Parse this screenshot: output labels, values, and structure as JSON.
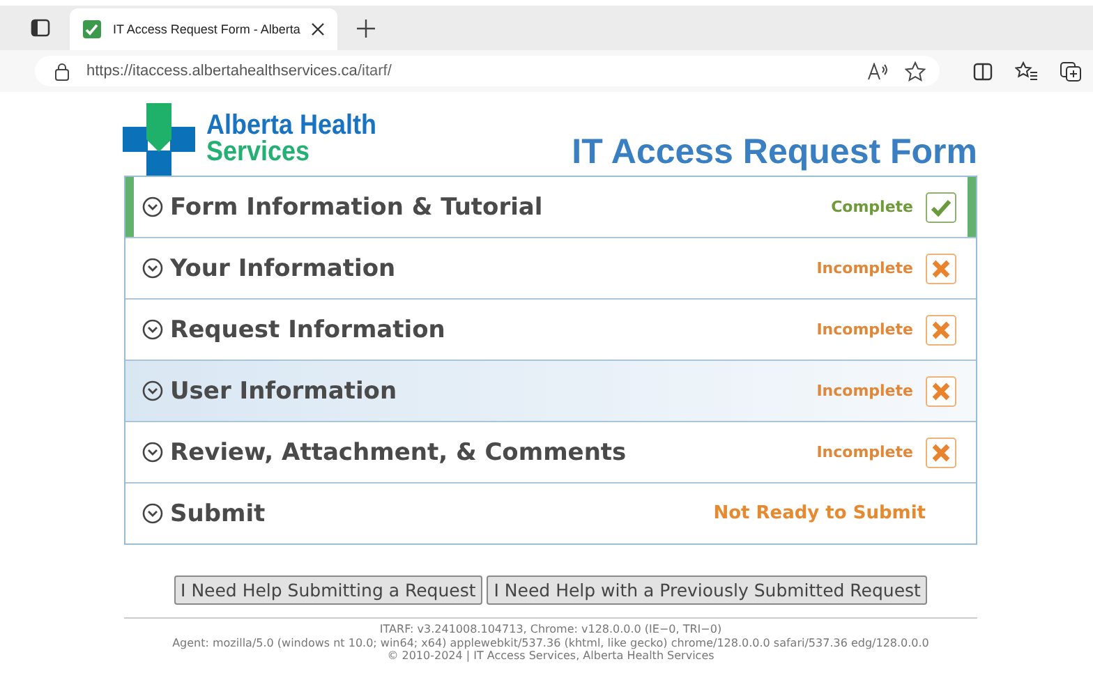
{
  "browser": {
    "tab_title": "IT Access Request Form - Alberta",
    "url_host": "https://itaccess.albertahealthservices.ca",
    "url_path": "/itarf/"
  },
  "logo": {
    "line1": "Alberta Health",
    "line2": "Services"
  },
  "title": "IT Access Request Form",
  "sections": [
    {
      "title": "Form Information & Tutorial",
      "kind": "complete",
      "status": "Complete",
      "highlighted": false
    },
    {
      "title": "Your Information",
      "kind": "incomplete",
      "status": "Incomplete",
      "highlighted": false
    },
    {
      "title": "Request Information",
      "kind": "incomplete",
      "status": "Incomplete",
      "highlighted": false
    },
    {
      "title": "User Information",
      "kind": "incomplete",
      "status": "Incomplete",
      "highlighted": true
    },
    {
      "title": "Review, Attachment, & Comments",
      "kind": "incomplete",
      "status": "Incomplete",
      "highlighted": false
    },
    {
      "title": "Submit",
      "kind": "submit",
      "status": "Not Ready to Submit",
      "highlighted": false
    }
  ],
  "buttons": [
    "I Need Help Submitting a Request",
    "I Need Help with a Previously Submitted Request"
  ],
  "footer": [
    "ITARF: v3.241008.104713, Chrome: v128.0.0.0 (IE−0, TRI−0)",
    "Agent: mozilla/5.0 (windows nt 10.0; win64; x64) applewebkit/537.36 (khtml, like gecko) chrome/128.0.0.0 safari/537.36 edg/128.0.0.0",
    "© 2010-2024 | IT Access Services, Alberta Health Services"
  ]
}
